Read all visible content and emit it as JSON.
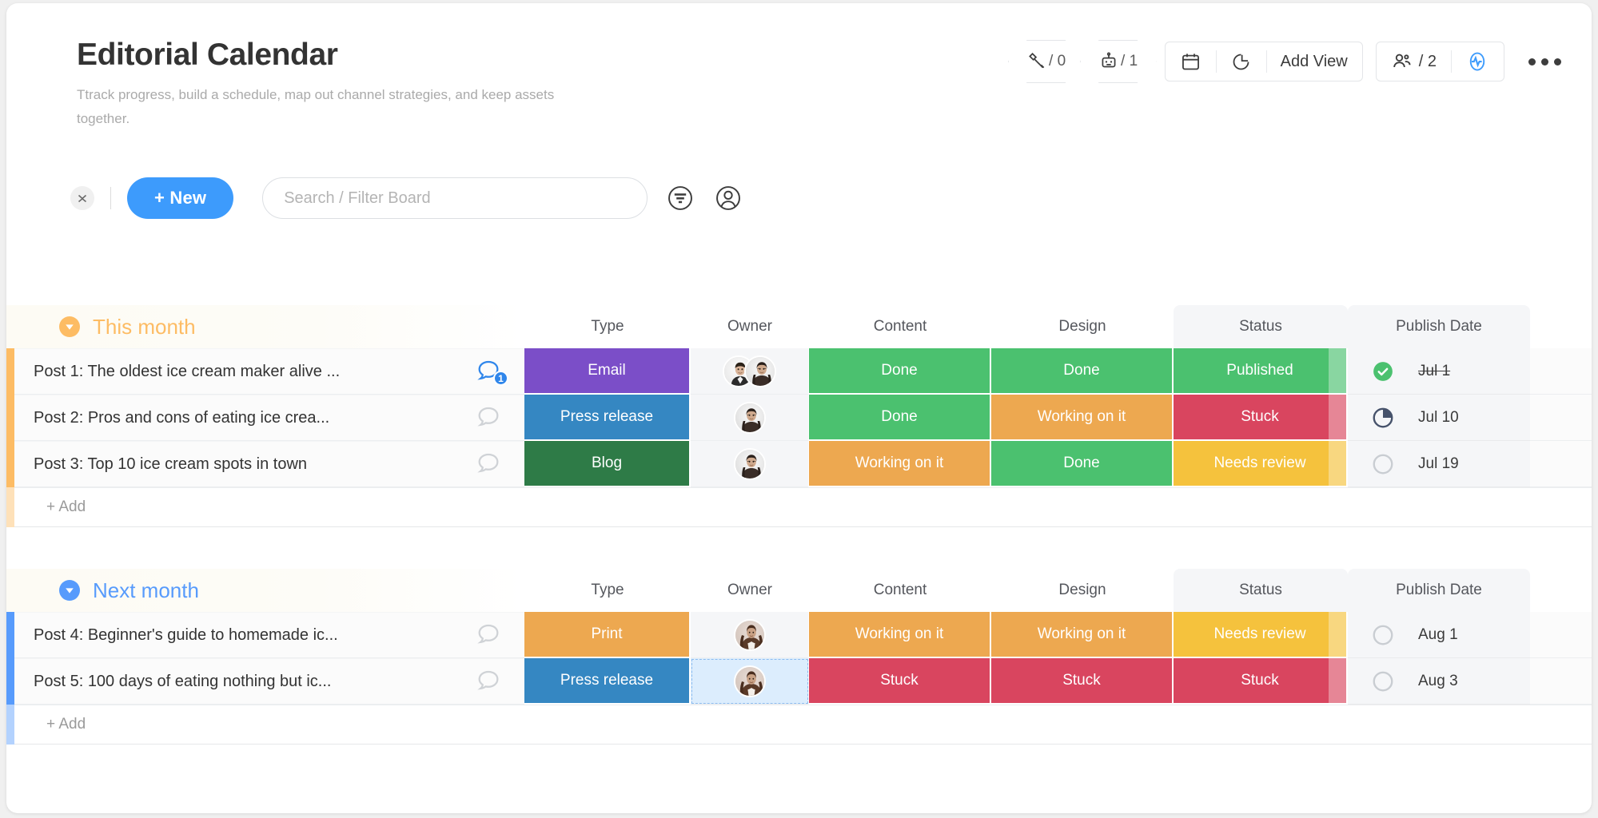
{
  "header": {
    "title": "Editorial Calendar",
    "description": "Ttrack progress, build a schedule, map out channel strategies, and keep assets together.",
    "badges": [
      {
        "icon": "integrations-plug-icon",
        "count": "/ 0"
      },
      {
        "icon": "automations-robot-icon",
        "count": "/ 1"
      }
    ],
    "view_group": [
      {
        "icon": "calendar-icon",
        "label": ""
      },
      {
        "icon": "pie-chart-icon",
        "label": ""
      },
      {
        "icon": "",
        "label": "Add View"
      }
    ],
    "people_group": [
      {
        "icon": "people-icon",
        "label": "/ 2"
      },
      {
        "icon": "activity-pulse-icon",
        "label": ""
      }
    ],
    "more_menu": "more-options-icon"
  },
  "toolbar": {
    "collapse_icon": "collapse-expand-icon",
    "new_label": "+ New",
    "search_placeholder": "Search / Filter Board",
    "search_value": "",
    "filter_icon": "filter-icon",
    "person_icon": "person-icon"
  },
  "columns": [
    "Type",
    "Owner",
    "Content",
    "Design",
    "Status",
    "Publish Date"
  ],
  "colors": {
    "accent_blue": "#3d9bfc",
    "group_this_month": "#fdbc64",
    "group_next_month": "#579bfc",
    "email": "#7b4ec8",
    "press_release": "#3587c2",
    "blog": "#2e7b47",
    "print": "#eda850",
    "done": "#4bc16f",
    "working_on_it": "#eda850",
    "stuck": "#d9455f",
    "needs_review": "#f5c23d",
    "published": "#4bc16f"
  },
  "groups": [
    {
      "name": "This month",
      "color": "#fdbc64",
      "toggle_icon": "chevron-down-circle-icon",
      "add_label": "+ Add",
      "rows": [
        {
          "name": "Post 1: The oldest ice cream maker alive ...",
          "comments": "1",
          "comment_active": true,
          "type": {
            "label": "Email",
            "color": "#7b4ec8"
          },
          "owners": [
            "male-avatar",
            "female-avatar"
          ],
          "owner_selected": false,
          "content": {
            "label": "Done",
            "color": "#4bc16f"
          },
          "design": {
            "label": "Done",
            "color": "#4bc16f"
          },
          "status": {
            "label": "Published",
            "color": "#4bc16f"
          },
          "date": {
            "text": "Jul 1",
            "struck": true,
            "indicator": "check-circle-icon"
          }
        },
        {
          "name": "Post 2: Pros and cons of eating ice crea...",
          "comments": "",
          "comment_active": false,
          "type": {
            "label": "Press release",
            "color": "#3587c2"
          },
          "owners": [
            "female-avatar"
          ],
          "owner_selected": false,
          "content": {
            "label": "Done",
            "color": "#4bc16f"
          },
          "design": {
            "label": "Working on it",
            "color": "#eda850"
          },
          "status": {
            "label": "Stuck",
            "color": "#d9455f"
          },
          "date": {
            "text": "Jul 10",
            "struck": false,
            "indicator": "partial-pie-icon"
          }
        },
        {
          "name": "Post 3: Top 10 ice cream spots in town",
          "comments": "",
          "comment_active": false,
          "type": {
            "label": "Blog",
            "color": "#2e7b47"
          },
          "owners": [
            "female-avatar"
          ],
          "owner_selected": false,
          "content": {
            "label": "Working on it",
            "color": "#eda850"
          },
          "design": {
            "label": "Done",
            "color": "#4bc16f"
          },
          "status": {
            "label": "Needs review",
            "color": "#f5c23d"
          },
          "date": {
            "text": "Jul 19",
            "struck": false,
            "indicator": "empty-circle-icon"
          }
        }
      ]
    },
    {
      "name": "Next month",
      "color": "#579bfc",
      "toggle_icon": "chevron-down-circle-icon",
      "add_label": "+ Add",
      "rows": [
        {
          "name": "Post 4: Beginner's guide to homemade ic...",
          "comments": "",
          "comment_active": false,
          "type": {
            "label": "Print",
            "color": "#eda850"
          },
          "owners": [
            "woman-avatar"
          ],
          "owner_selected": false,
          "content": {
            "label": "Working on it",
            "color": "#eda850"
          },
          "design": {
            "label": "Working on it",
            "color": "#eda850"
          },
          "status": {
            "label": "Needs review",
            "color": "#f5c23d"
          },
          "date": {
            "text": "Aug 1",
            "struck": false,
            "indicator": "empty-circle-icon"
          }
        },
        {
          "name": "Post 5: 100 days of eating nothing but ic...",
          "comments": "",
          "comment_active": false,
          "type": {
            "label": "Press release",
            "color": "#3587c2"
          },
          "owners": [
            "woman-avatar"
          ],
          "owner_selected": true,
          "content": {
            "label": "Stuck",
            "color": "#d9455f"
          },
          "design": {
            "label": "Stuck",
            "color": "#d9455f"
          },
          "status": {
            "label": "Stuck",
            "color": "#d9455f"
          },
          "date": {
            "text": "Aug 3",
            "struck": false,
            "indicator": "empty-circle-icon"
          }
        }
      ]
    }
  ]
}
